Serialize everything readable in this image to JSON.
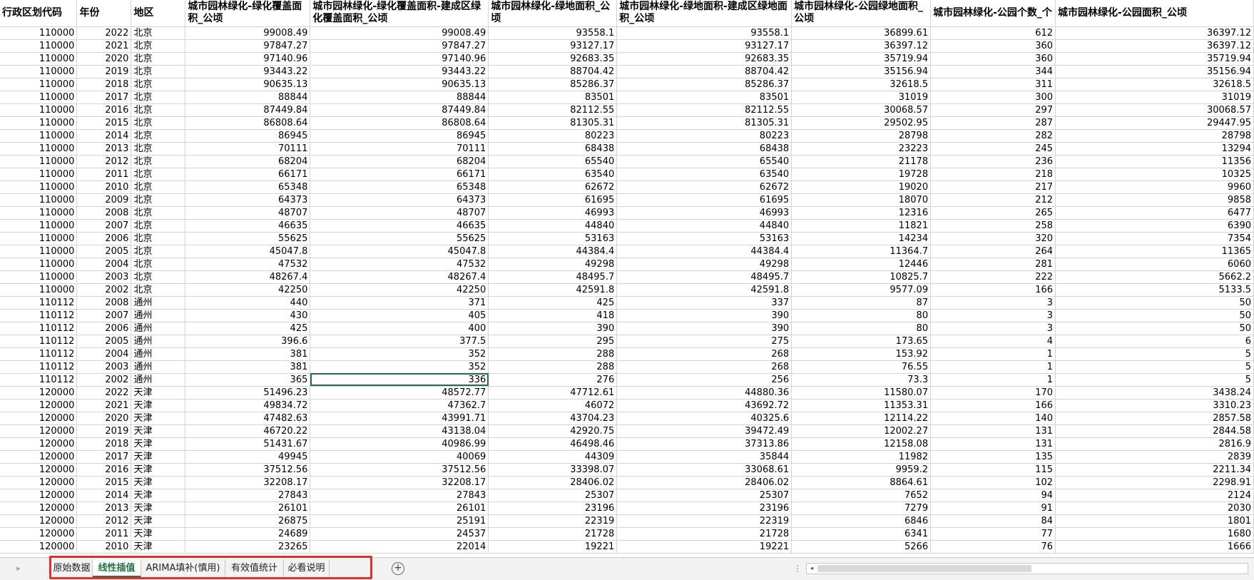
{
  "columns": [
    "行政区划代码",
    "年份",
    "地区",
    "城市园林绿化-绿化覆盖面积_公顷",
    "城市园林绿化-绿化覆盖面积-建成区绿化覆盖面积_公顷",
    "城市园林绿化-绿地面积_公顷",
    "城市园林绿化-绿地面积-建成区绿地面积_公顷",
    "城市园林绿化-公园绿地面积_公顷",
    "城市园林绿化-公园个数_个",
    "城市园林绿化-公园面积_公顷"
  ],
  "rows": [
    [
      "110000",
      "2022",
      "北京",
      "99008.49",
      "99008.49",
      "93558.1",
      "93558.1",
      "36899.61",
      "612",
      "36397.12"
    ],
    [
      "110000",
      "2021",
      "北京",
      "97847.27",
      "97847.27",
      "93127.17",
      "93127.17",
      "36397.12",
      "360",
      "36397.12"
    ],
    [
      "110000",
      "2020",
      "北京",
      "97140.96",
      "97140.96",
      "92683.35",
      "92683.35",
      "35719.94",
      "360",
      "35719.94"
    ],
    [
      "110000",
      "2019",
      "北京",
      "93443.22",
      "93443.22",
      "88704.42",
      "88704.42",
      "35156.94",
      "344",
      "35156.94"
    ],
    [
      "110000",
      "2018",
      "北京",
      "90635.13",
      "90635.13",
      "85286.37",
      "85286.37",
      "32618.5",
      "311",
      "32618.5"
    ],
    [
      "110000",
      "2017",
      "北京",
      "88844",
      "88844",
      "83501",
      "83501",
      "31019",
      "300",
      "31019"
    ],
    [
      "110000",
      "2016",
      "北京",
      "87449.84",
      "87449.84",
      "82112.55",
      "82112.55",
      "30068.57",
      "297",
      "30068.57"
    ],
    [
      "110000",
      "2015",
      "北京",
      "86808.64",
      "86808.64",
      "81305.31",
      "81305.31",
      "29502.95",
      "287",
      "29447.95"
    ],
    [
      "110000",
      "2014",
      "北京",
      "86945",
      "86945",
      "80223",
      "80223",
      "28798",
      "282",
      "28798"
    ],
    [
      "110000",
      "2013",
      "北京",
      "70111",
      "70111",
      "68438",
      "68438",
      "23223",
      "245",
      "13294"
    ],
    [
      "110000",
      "2012",
      "北京",
      "68204",
      "68204",
      "65540",
      "65540",
      "21178",
      "236",
      "11356"
    ],
    [
      "110000",
      "2011",
      "北京",
      "66171",
      "66171",
      "63540",
      "63540",
      "19728",
      "218",
      "10325"
    ],
    [
      "110000",
      "2010",
      "北京",
      "65348",
      "65348",
      "62672",
      "62672",
      "19020",
      "217",
      "9960"
    ],
    [
      "110000",
      "2009",
      "北京",
      "64373",
      "64373",
      "61695",
      "61695",
      "18070",
      "212",
      "9858"
    ],
    [
      "110000",
      "2008",
      "北京",
      "48707",
      "48707",
      "46993",
      "46993",
      "12316",
      "265",
      "6477"
    ],
    [
      "110000",
      "2007",
      "北京",
      "46635",
      "46635",
      "44840",
      "44840",
      "11821",
      "258",
      "6390"
    ],
    [
      "110000",
      "2006",
      "北京",
      "55625",
      "55625",
      "53163",
      "53163",
      "14234",
      "320",
      "7354"
    ],
    [
      "110000",
      "2005",
      "北京",
      "45047.8",
      "45047.8",
      "44384.4",
      "44384.4",
      "11364.7",
      "264",
      "11365"
    ],
    [
      "110000",
      "2004",
      "北京",
      "47532",
      "47532",
      "49298",
      "49298",
      "12446",
      "281",
      "6060"
    ],
    [
      "110000",
      "2003",
      "北京",
      "48267.4",
      "48267.4",
      "48495.7",
      "48495.7",
      "10825.7",
      "222",
      "5662.2"
    ],
    [
      "110000",
      "2002",
      "北京",
      "42250",
      "42250",
      "42591.8",
      "42591.8",
      "9577.09",
      "166",
      "5133.5"
    ],
    [
      "110112",
      "2008",
      "通州",
      "440",
      "371",
      "425",
      "337",
      "87",
      "3",
      "50"
    ],
    [
      "110112",
      "2007",
      "通州",
      "430",
      "405",
      "418",
      "390",
      "80",
      "3",
      "50"
    ],
    [
      "110112",
      "2006",
      "通州",
      "425",
      "400",
      "390",
      "390",
      "80",
      "3",
      "50"
    ],
    [
      "110112",
      "2005",
      "通州",
      "396.6",
      "377.5",
      "295",
      "275",
      "173.65",
      "4",
      "6"
    ],
    [
      "110112",
      "2004",
      "通州",
      "381",
      "352",
      "288",
      "268",
      "153.92",
      "1",
      "5"
    ],
    [
      "110112",
      "2003",
      "通州",
      "381",
      "352",
      "288",
      "268",
      "76.55",
      "1",
      "5"
    ],
    [
      "110112",
      "2002",
      "通州",
      "365",
      "336",
      "276",
      "256",
      "73.3",
      "1",
      "5"
    ],
    [
      "120000",
      "2022",
      "天津",
      "51496.23",
      "48572.77",
      "47712.61",
      "44880.36",
      "11580.07",
      "170",
      "3438.24"
    ],
    [
      "120000",
      "2021",
      "天津",
      "49834.72",
      "47362.7",
      "46072",
      "43692.72",
      "11353.31",
      "166",
      "3310.23"
    ],
    [
      "120000",
      "2020",
      "天津",
      "47482.63",
      "43991.71",
      "43704.23",
      "40325.6",
      "12114.22",
      "140",
      "2857.58"
    ],
    [
      "120000",
      "2019",
      "天津",
      "46720.22",
      "43138.04",
      "42920.75",
      "39472.49",
      "12002.27",
      "131",
      "2844.58"
    ],
    [
      "120000",
      "2018",
      "天津",
      "51431.67",
      "40986.99",
      "46498.46",
      "37313.86",
      "12158.08",
      "131",
      "2816.9"
    ],
    [
      "120000",
      "2017",
      "天津",
      "49945",
      "40069",
      "44309",
      "35844",
      "11982",
      "135",
      "2839"
    ],
    [
      "120000",
      "2016",
      "天津",
      "37512.56",
      "37512.56",
      "33398.07",
      "33068.61",
      "9959.2",
      "115",
      "2211.34"
    ],
    [
      "120000",
      "2015",
      "天津",
      "32208.17",
      "32208.17",
      "28406.02",
      "28406.02",
      "8864.61",
      "102",
      "2298.91"
    ],
    [
      "120000",
      "2014",
      "天津",
      "27843",
      "27843",
      "25307",
      "25307",
      "7652",
      "94",
      "2124"
    ],
    [
      "120000",
      "2013",
      "天津",
      "26101",
      "26101",
      "23196",
      "23196",
      "7279",
      "91",
      "2030"
    ],
    [
      "120000",
      "2012",
      "天津",
      "26875",
      "25191",
      "22319",
      "22319",
      "6846",
      "84",
      "1801"
    ],
    [
      "120000",
      "2011",
      "天津",
      "24689",
      "24537",
      "21728",
      "21728",
      "6341",
      "77",
      "1680"
    ],
    [
      "120000",
      "2010",
      "天津",
      "23265",
      "22014",
      "19221",
      "19221",
      "5266",
      "76",
      "1666"
    ]
  ],
  "sheet_tabs": [
    {
      "label": "原始数据",
      "active": false
    },
    {
      "label": "线性插值",
      "active": true
    },
    {
      "label": "ARIMA填补(慎用)",
      "active": false
    },
    {
      "label": "有效值统计",
      "active": false
    },
    {
      "label": "必看说明",
      "active": false
    }
  ],
  "selected_cell": {
    "row": 27,
    "col": 4
  },
  "icons": {
    "add_sheet": "plus-circle-icon",
    "split": "vertical-ellipsis-icon",
    "scroll_left": "caret-left-icon",
    "tab_nav": "caret-right-icon"
  },
  "colors": {
    "accent": "#217346",
    "highlight_box": "#e03030",
    "grid_line": "#d4d4d4"
  }
}
